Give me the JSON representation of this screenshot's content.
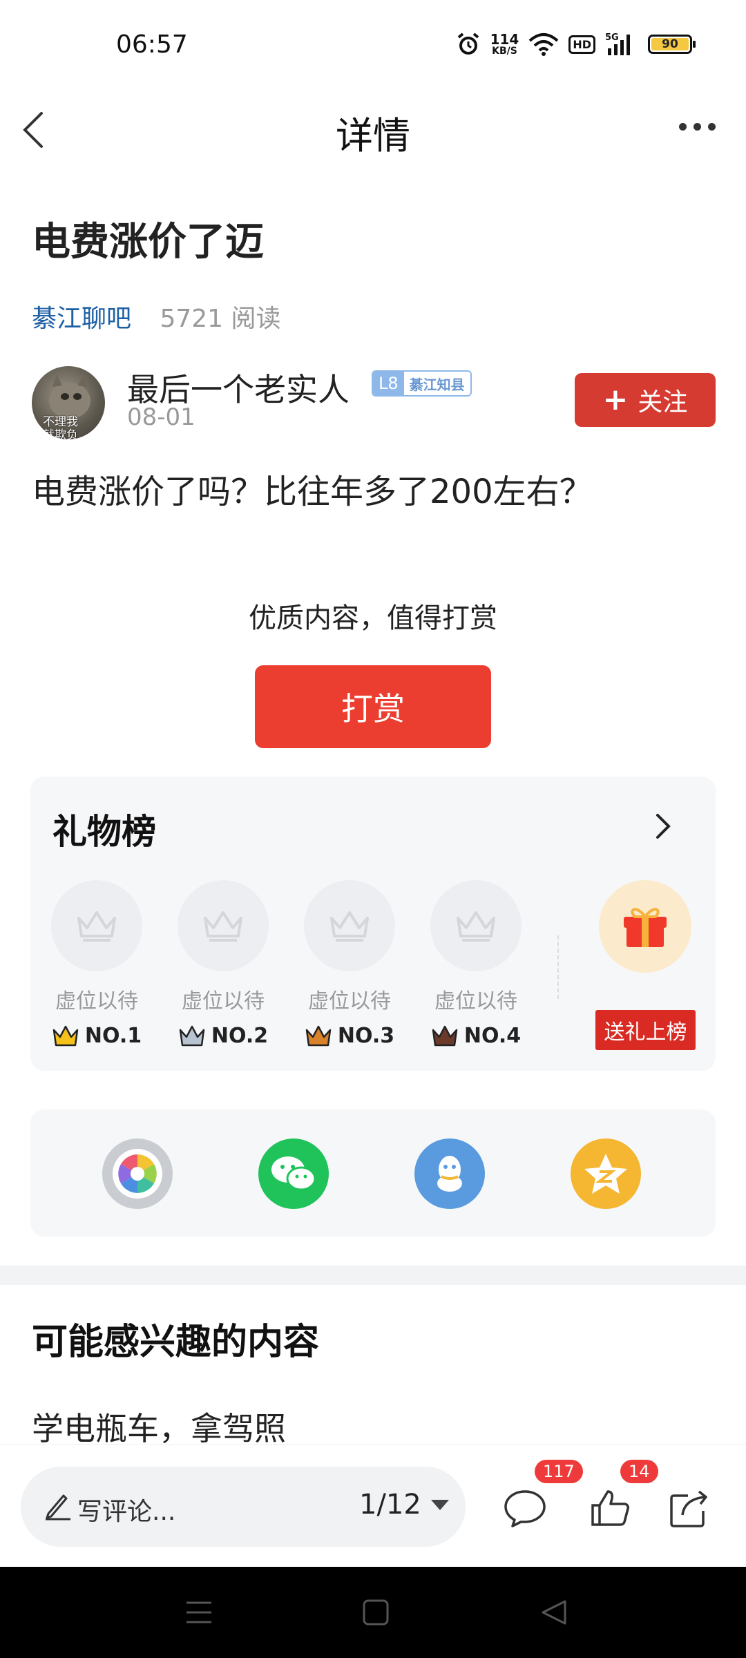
{
  "status_bar": {
    "time": "06:57",
    "net_speed_value": "114",
    "net_speed_unit": "KB/S",
    "hd": "HD",
    "signal": "5G",
    "battery": "90",
    "icons": [
      "alarm-icon",
      "wifi-icon",
      "signal-icon",
      "battery-icon"
    ]
  },
  "nav": {
    "title": "详情",
    "back_icon": "back-chevron-icon",
    "more_icon": "more-dots-icon"
  },
  "post": {
    "title": "电费涨价了迈",
    "forum": "綦江聊吧",
    "reads": "5721 阅读",
    "author": {
      "name": "最后一个老实人",
      "level": "L8",
      "level_title": "綦江知县",
      "date": "08-01",
      "avatar_text": "不理我\n就欺负",
      "follow_plus": "+",
      "follow_label": "关注"
    },
    "body": "电费涨价了吗？比往年多了200左右？"
  },
  "reward": {
    "prompt": "优质内容，值得打赏",
    "button": "打赏"
  },
  "gift_board": {
    "title": "礼物榜",
    "slots": [
      {
        "label": "虚位以待",
        "rank": "NO.1",
        "crown_color": "#f4c21b"
      },
      {
        "label": "虚位以待",
        "rank": "NO.2",
        "crown_color": "#b8c4d2"
      },
      {
        "label": "虚位以待",
        "rank": "NO.3",
        "crown_color": "#d9822b"
      },
      {
        "label": "虚位以待",
        "rank": "NO.4",
        "crown_color": "#6b3a2a"
      }
    ],
    "send_label": "送礼上榜"
  },
  "share": {
    "items": [
      "moments-icon",
      "wechat-icon",
      "qq-icon",
      "qzone-icon"
    ]
  },
  "interest": {
    "title": "可能感兴趣的内容",
    "items": [
      "学电瓶车，拿驾照"
    ]
  },
  "bottom_bar": {
    "comment_placeholder": "写评论...",
    "page": "1/12",
    "comment_count": "117",
    "like_count": "14"
  },
  "colors": {
    "accent_red": "#d63b32",
    "reward_red": "#ec3e30",
    "forum_blue": "#1d5fa4",
    "wechat_green": "#1fc35a",
    "qq_blue": "#5a9be0",
    "qzone_yellow": "#f5b631"
  }
}
